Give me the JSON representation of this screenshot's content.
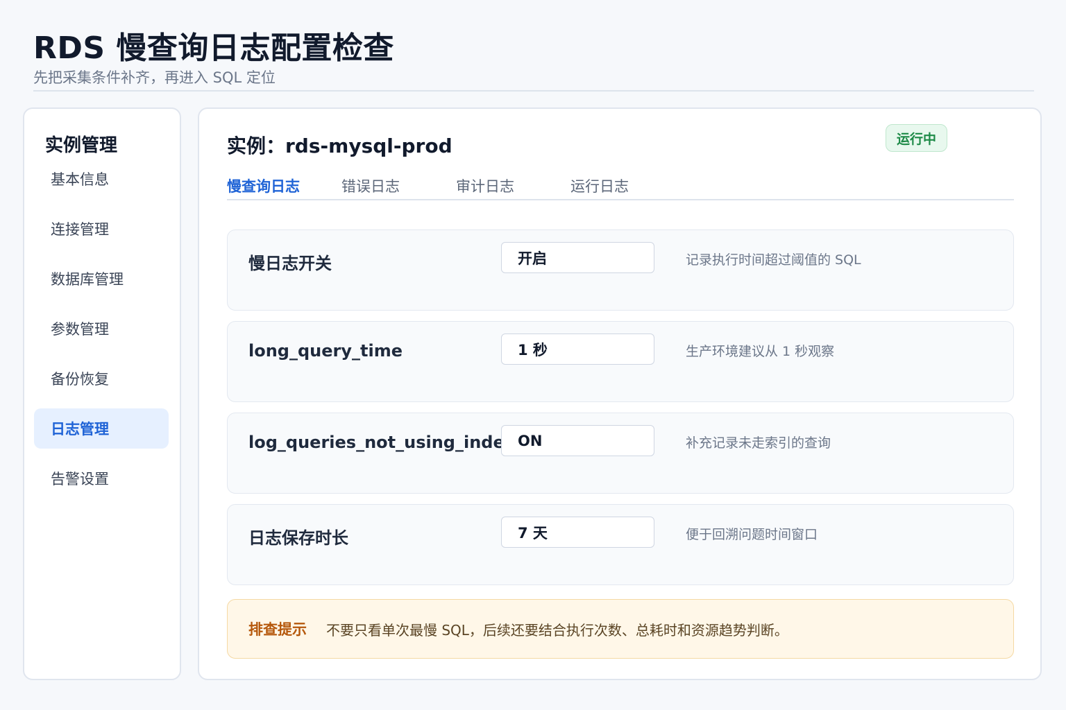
{
  "header": {
    "title": "RDS 慢查询日志配置检查",
    "subtitle": "先把采集条件补齐，再进入 SQL 定位"
  },
  "sidebar": {
    "title": "实例管理",
    "items": [
      {
        "label": "基本信息"
      },
      {
        "label": "连接管理"
      },
      {
        "label": "数据库管理"
      },
      {
        "label": "参数管理"
      },
      {
        "label": "备份恢复"
      },
      {
        "label": "日志管理",
        "active": true
      },
      {
        "label": "告警设置"
      }
    ]
  },
  "main": {
    "instance_title": "实例：rds-mysql-prod",
    "status": "运行中",
    "tabs": [
      {
        "label": "慢查询日志",
        "active": true
      },
      {
        "label": "错误日志"
      },
      {
        "label": "审计日志"
      },
      {
        "label": "运行日志"
      }
    ],
    "settings": [
      {
        "label": "慢日志开关",
        "value": "开启",
        "desc": "记录执行时间超过阈值的 SQL"
      },
      {
        "label": "long_query_time",
        "value": "1 秒",
        "desc": "生产环境建议从 1 秒观察"
      },
      {
        "label": "log_queries_not_using_indexes",
        "value": "ON",
        "desc": "补充记录未走索引的查询"
      },
      {
        "label": "日志保存时长",
        "value": "7 天",
        "desc": "便于回溯问题时间窗口"
      }
    ],
    "tip": {
      "label": "排查提示",
      "text": "不要只看单次最慢 SQL，后续还要结合执行次数、总耗时和资源趋势判断。"
    }
  }
}
